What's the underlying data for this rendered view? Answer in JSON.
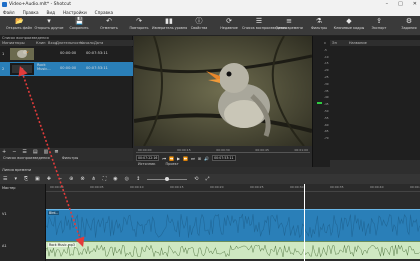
{
  "window": {
    "title": "Video+Audio.mlt* - Shotcut",
    "controls": [
      "–",
      "□",
      "✕"
    ]
  },
  "menu": [
    "Файл",
    "Правка",
    "Вид",
    "Настройки",
    "Справка"
  ],
  "toolbar": [
    {
      "icon": "folder-open-icon",
      "glyph": "📂",
      "label": "Открыть файл"
    },
    {
      "icon": "open-other-icon",
      "glyph": "▾",
      "label": "Открыть другое"
    },
    {
      "icon": "save-icon",
      "glyph": "💾",
      "label": "Сохранить"
    },
    {
      "icon": "undo-icon",
      "glyph": "↶",
      "label": "Отменить"
    },
    {
      "icon": "redo-icon",
      "glyph": "↷",
      "label": "Повторить"
    },
    {
      "icon": "peak-meter-icon",
      "glyph": "▮▮",
      "label": "Измеритель уровня"
    },
    {
      "icon": "properties-icon",
      "glyph": "ⓘ",
      "label": "Свойства"
    },
    {
      "icon": "recent-icon",
      "glyph": "⟳",
      "label": "Недавние"
    },
    {
      "icon": "playlist-icon",
      "glyph": "☰",
      "label": "Список воспроизведения"
    },
    {
      "icon": "timeline-icon",
      "glyph": "≡",
      "label": "Линия времени"
    },
    {
      "icon": "filters-icon",
      "glyph": "⚗",
      "label": "Фильтры"
    },
    {
      "icon": "keyframes-icon",
      "glyph": "◆",
      "label": "Ключевые кадры"
    },
    {
      "icon": "export-icon",
      "glyph": "⇪",
      "label": "Экспорт"
    },
    {
      "icon": "jobs-icon",
      "glyph": "⚙",
      "label": "Задания"
    }
  ],
  "playlist": {
    "panel_label": "Список воспроизведения",
    "columns": [
      "Миниатюры",
      "Клип",
      "Вход",
      "Длительность",
      "Начало",
      "Дата"
    ],
    "rows": [
      {
        "num": "1",
        "name": "",
        "start": "00:00:00",
        "dur": "00:07:53:11"
      },
      {
        "num": "2",
        "name": "Rock Music...",
        "start": "00:00:00",
        "dur": "00:07:53:11"
      }
    ],
    "tabs": [
      "Список воспроизведения",
      "Фильтры"
    ],
    "buttons": [
      "+",
      "−",
      "☰",
      "▤",
      "▥",
      "≣"
    ]
  },
  "player": {
    "ruler": [
      "00:00:00",
      "00:00:15",
      "00:00:30",
      "00:00:45",
      "00:01:00"
    ],
    "timecode_current": "00:07:22:16",
    "timecode_total": "00:07:53:11",
    "tabs": [
      "Источник",
      "Проект"
    ]
  },
  "meter": {
    "scale": [
      "0",
      "-5",
      "-10",
      "-15",
      "-20",
      "-25",
      "-30",
      "-35",
      "-40",
      "-45",
      "-50",
      "-55",
      "-60",
      "-65",
      "-70"
    ]
  },
  "properties": {
    "header": [
      "Эл",
      "Название"
    ]
  },
  "timeline": {
    "title": "Линия времени",
    "master_label": "Мастер",
    "tracks": {
      "video": "V1",
      "audio": "A1"
    },
    "ruler": [
      "00:00:00",
      "00:00:05",
      "00:00:10",
      "00:00:15",
      "00:00:20",
      "00:00:25",
      "00:00:30",
      "00:00:35",
      "00:00:40",
      "00:00:45"
    ],
    "video_clip": "Bird...",
    "audio_clip": "Rock Music.mp3",
    "tools": [
      "☰",
      "▾",
      "⎘",
      "▣",
      "✚",
      "−",
      "⊕",
      "⊗",
      "⋔",
      "⛶",
      "◉",
      "◎",
      "↕",
      "⟲",
      "⤢"
    ]
  },
  "colors": {
    "video_track": "#2a7fb8",
    "audio_track": "#cfe8c2",
    "arrow": "#e23b3b",
    "selection": "#2a7fb8"
  }
}
